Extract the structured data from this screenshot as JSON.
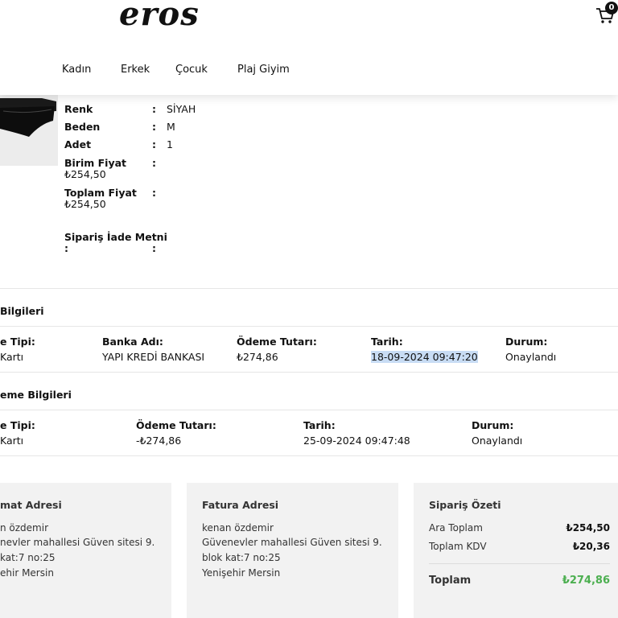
{
  "header": {
    "logo": "eros",
    "cart_count": "0",
    "nav": [
      "Kadın",
      "Erkek",
      "Çocuk",
      "Plaj Giyim"
    ]
  },
  "product": {
    "rows": [
      {
        "label": "Renk",
        "value": "SİYAH"
      },
      {
        "label": "Beden",
        "value": "M"
      },
      {
        "label": "Adet",
        "value": "1"
      },
      {
        "label": "Birim Fiyat",
        "value": "",
        "sub": "₺254,50"
      },
      {
        "label": "Toplam Fiyat",
        "value": "",
        "sub": "₺254,50"
      },
      {
        "label": "Sipariş İade Metni",
        "value": "",
        "sub": ":"
      }
    ],
    "colon": ":"
  },
  "payment": {
    "title": "Bilgileri",
    "headers": [
      "e Tipi:",
      "Banka Adı:",
      "Ödeme Tutarı:",
      "Tarih:",
      "Durum:"
    ],
    "values": [
      "Kartı",
      "YAPI KREDİ BANKASI",
      "₺274,86",
      "18-09-2024 09:47:20",
      "Onaylandı"
    ]
  },
  "refund": {
    "title": "eme Bilgileri",
    "headers": [
      "e Tipi:",
      "Ödeme Tutarı:",
      "Tarih:",
      "Durum:"
    ],
    "values": [
      "Kartı",
      "-₺274,86",
      "25-09-2024 09:47:48",
      "Onaylandı"
    ]
  },
  "shipping_address": {
    "title": "mat Adresi",
    "lines": [
      "n özdemir",
      "nevler mahallesi Güven sitesi 9.",
      "kat:7 no:25",
      "ehir Mersin"
    ]
  },
  "billing_address": {
    "title": "Fatura Adresi",
    "lines": [
      "kenan özdemir",
      "Güvenevler mahallesi Güven sitesi 9.",
      "blok kat:7 no:25",
      "Yenişehir Mersin"
    ]
  },
  "summary": {
    "title": "Sipariş Özeti",
    "subtotal_label": "Ara Toplam",
    "subtotal": "₺254,50",
    "tax_label": "Toplam KDV",
    "tax": "₺20,36",
    "total_label": "Toplam",
    "total": "₺274,86",
    "total_color": "#4caf50"
  }
}
